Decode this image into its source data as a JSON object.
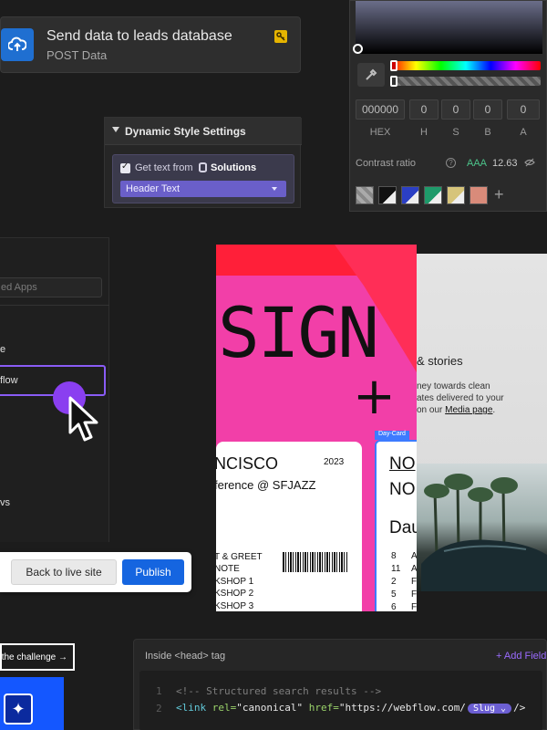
{
  "integration": {
    "title": "Send data to leads database",
    "subtitle": "POST Data",
    "icon": "cloud-upload-icon",
    "badge_icon": "key-icon"
  },
  "dynamic_style": {
    "title": "Dynamic Style Settings",
    "get_text_label": "Get text from",
    "source": "Solutions",
    "field": "Header Text",
    "checked": true
  },
  "color_picker": {
    "fields": [
      "000000",
      "0",
      "0",
      "0",
      "0"
    ],
    "labels": [
      "HEX",
      "H",
      "S",
      "B",
      "A"
    ],
    "contrast_label": "Contrast ratio",
    "contrast_grade": "AAA",
    "contrast_value": "12.63",
    "swatches": [
      "#aaaaaa",
      "#111111",
      "#2b3fc4",
      "#1e9a6a",
      "#d6c47a",
      "#d98b7a"
    ],
    "add_label": "+"
  },
  "sidebar": {
    "search_placeholder": "ed Apps",
    "items": [
      {
        "label": "e"
      },
      {
        "label": "flow"
      },
      {
        "label": "vs"
      }
    ]
  },
  "publish_bar": {
    "back_label": "Back to live site",
    "publish_label": "Publish"
  },
  "design_preview": {
    "headline": "SIGN",
    "plus": "+",
    "ticket": {
      "city": "NCISCO",
      "year": "2023",
      "conference": "ference @ SFJAZZ",
      "lines": [
        "T & GREET",
        "NOTE",
        "KSHOP 1",
        "KSHOP 2",
        "KSHOP 3"
      ]
    },
    "card_tag": "Day-Card",
    "card_b": {
      "line1": "NO",
      "line2": "NO",
      "line3": "Dau",
      "numbers": [
        {
          "num": "8",
          "letter": "A"
        },
        {
          "num": "11",
          "letter": "A"
        },
        {
          "num": "2",
          "letter": "F"
        },
        {
          "num": "5",
          "letter": "F"
        },
        {
          "num": "6",
          "letter": "F"
        }
      ]
    }
  },
  "stories": {
    "title": "& stories",
    "lines": [
      "ney towards clean",
      "ates delivered to your",
      "on our"
    ],
    "link": "Media page",
    "link_suffix": "."
  },
  "code_editor": {
    "title": "Inside <head> tag",
    "add_field": "+ Add Field",
    "line1_num": "1",
    "line2_num": "2",
    "line1": "<!-- Structured search results -->",
    "line2_tag_open": "<link",
    "line2_attr1": "rel=",
    "line2_val1": "\"canonical\"",
    "line2_attr2": "href=",
    "line2_val2": "\"https://webflow.com/",
    "slug": "Slug",
    "line2_end": "/>"
  },
  "challenge": {
    "button_label": "n the challenge →",
    "icon": "calendar-star-icon"
  }
}
